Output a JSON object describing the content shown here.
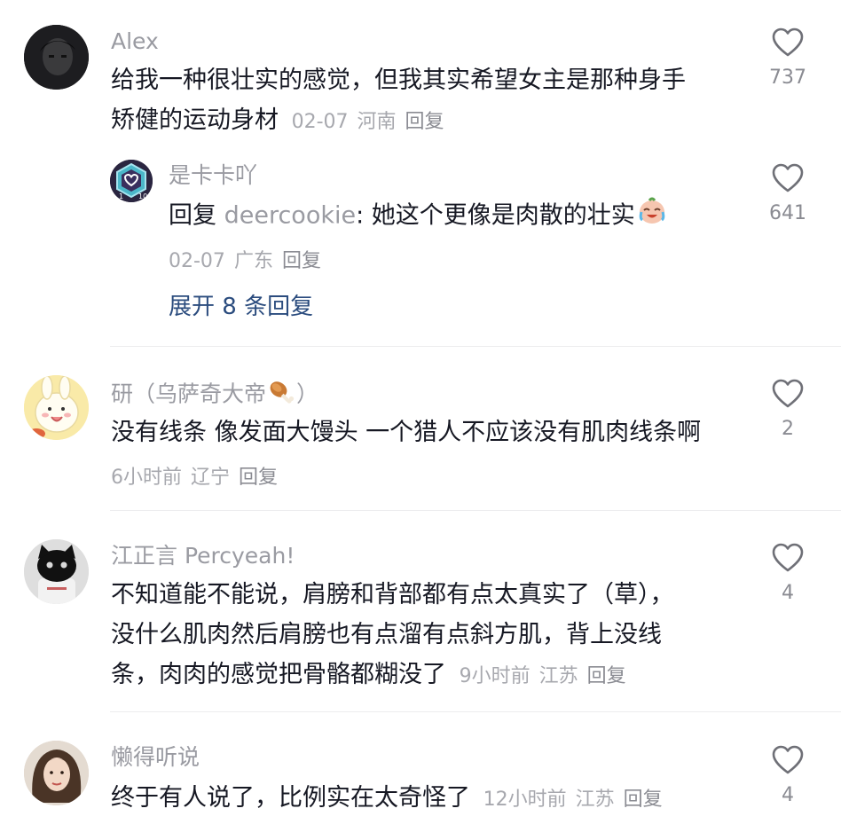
{
  "comments": [
    {
      "username": "Alex",
      "line1": "给我一种很壮实的感觉，但我其实希望女主是那种身手",
      "line2": "矫健的运动身材",
      "date": "02-07",
      "location": "河南",
      "reply_label": "回复",
      "likes": "737",
      "avatar_icon": "dark-portrait-avatar",
      "sub_reply": {
        "username": "是卡卡吖",
        "prefix": "回复",
        "reply_to": "deercookie",
        "text": ": 她这个更像是肉散的壮实",
        "emoji": "crying-laughing-face-emoji",
        "date": "02-07",
        "location": "广东",
        "reply_label": "回复",
        "likes": "641",
        "avatar_icon": "level-badge-avatar"
      },
      "expand_label": "展开 8 条回复"
    },
    {
      "username": "研（乌萨奇大帝",
      "username_suffix": "）",
      "username_emoji": "drumstick-emoji",
      "line1": "没有线条 像发面大馒头 一个猎人不应该没有肌肉线条啊",
      "date": "6小时前",
      "location": "辽宁",
      "reply_label": "回复",
      "likes": "2",
      "avatar_icon": "cartoon-rabbit-avatar"
    },
    {
      "username": "江正言 Percyeah!",
      "line1": "不知道能不能说，肩膀和背部都有点太真实了（草），",
      "line2": "没什么肌肉然后肩膀也有点溜有点斜方肌，背上没线",
      "line3": "条，肉肉的感觉把骨骼都糊没了",
      "date": "9小时前",
      "location": "江苏",
      "reply_label": "回复",
      "likes": "4",
      "avatar_icon": "black-cat-avatar"
    },
    {
      "username": "懒得听说",
      "line1": "终于有人说了，比例实在太奇怪了",
      "date": "12小时前",
      "location": "江苏",
      "reply_label": "回复",
      "likes": "4",
      "avatar_icon": "girl-portrait-avatar"
    }
  ],
  "colors": {
    "username": "#9a9ba2",
    "text": "#161823",
    "meta": "#a7a8ae",
    "expand": "#2b4c7e",
    "divider": "#ececee"
  }
}
